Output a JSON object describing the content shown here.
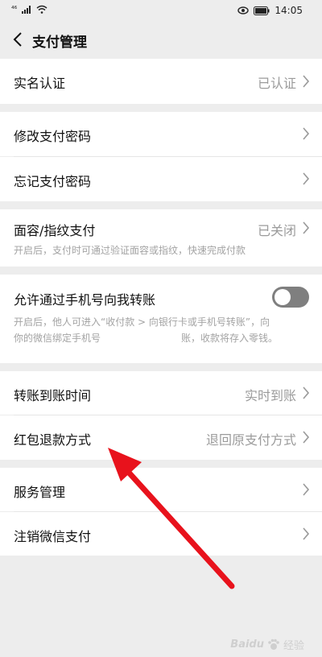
{
  "status_bar": {
    "signal": "⁴⁶",
    "time": "14:05"
  },
  "header": {
    "title": "支付管理"
  },
  "rows": {
    "real_name": {
      "label": "实名认证",
      "value": "已认证"
    },
    "change_pwd": {
      "label": "修改支付密码"
    },
    "forgot_pwd": {
      "label": "忘记支付密码"
    },
    "face_finger": {
      "label": "面容/指纹支付",
      "value": "已关闭",
      "desc": "开启后，支付时可通过验证面容或指纹，快速完成付款"
    },
    "phone_transfer": {
      "label": "允许通过手机号向我转账",
      "toggle_on": false,
      "desc_line1": "开启后，他人可进入“收付款 > 向银行卡或手机号转账”，向",
      "desc_line2_a": "你的微信绑定手机号",
      "desc_line2_b": "账，收款将存入零钱。"
    },
    "transfer_time": {
      "label": "转账到账时间",
      "value": "实时到账"
    },
    "redpacket_refund": {
      "label": "红包退款方式",
      "value": "退回原支付方式"
    },
    "service_mgmt": {
      "label": "服务管理"
    },
    "cancel_pay": {
      "label": "注销微信支付"
    }
  },
  "watermark": {
    "text": "经验",
    "brand": "Baidu"
  },
  "colors": {
    "annotation_arrow": "#e8121c",
    "background": "#ededed"
  }
}
